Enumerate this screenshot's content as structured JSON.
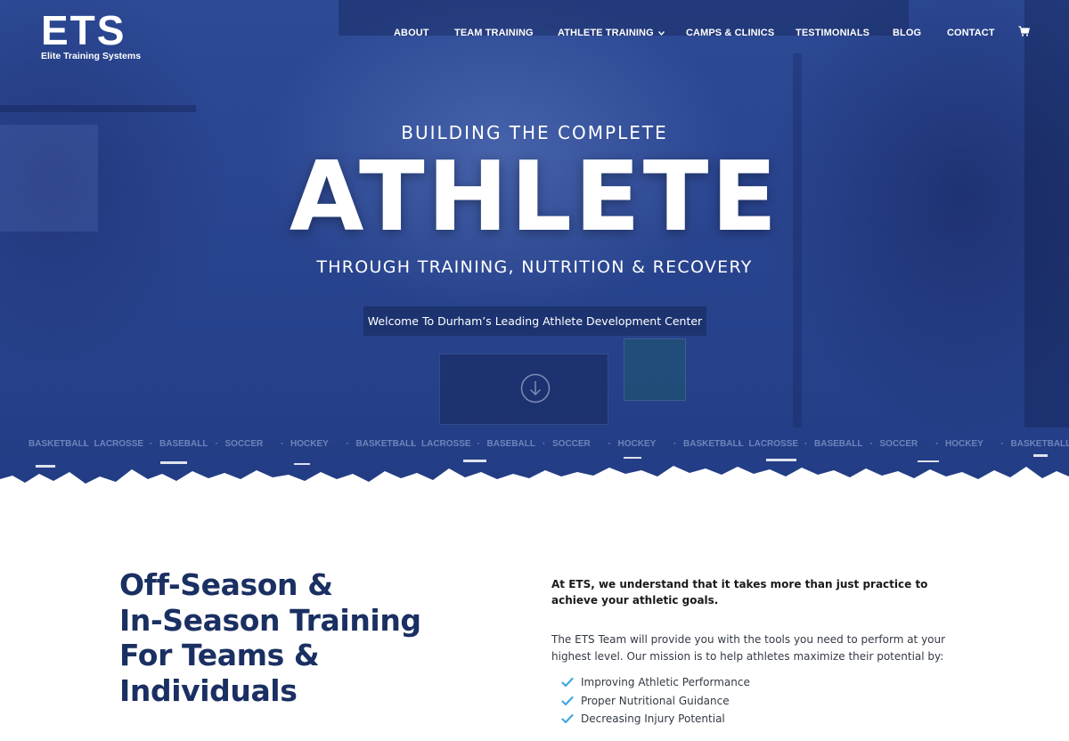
{
  "brand": {
    "logo_text": "ETS",
    "logo_subtitle": "Elite Training Systems",
    "accent_color": "#2a4590",
    "heading_color": "#1a2f62",
    "check_color": "#3fa9e0"
  },
  "nav": {
    "items": [
      {
        "label": "ABOUT"
      },
      {
        "label": "TEAM TRAINING"
      },
      {
        "label": "ATHLETE TRAINING",
        "has_dropdown": true
      },
      {
        "label": "CAMPS & CLINICS"
      },
      {
        "label": "TESTIMONIALS"
      },
      {
        "label": "BLOG"
      },
      {
        "label": "CONTACT"
      }
    ],
    "cart_icon": "cart-icon"
  },
  "hero": {
    "kicker": "BUILDING THE COMPLETE",
    "headline": "ATHLETE",
    "subline": "THROUGH TRAINING, NUTRITION & RECOVERY",
    "welcome_label": "Welcome To Durham’s Leading Athlete Development Center",
    "scroll_icon": "arrow-down-circle-icon",
    "ticker_items": [
      "BASKETBALL",
      "LACROSSE",
      "BASEBALL",
      "SOCCER",
      "HOCKEY",
      "BASKETBALL",
      "LACROSSE",
      "BASEBALL",
      "SOCCER",
      "HOCKEY",
      "BASKETBALL",
      "LACROSSE",
      "BASEBALL",
      "SOCCER",
      "HOCKEY",
      "BASKETBALL"
    ]
  },
  "intro": {
    "heading_lines": [
      "Off-Season &",
      "In-Season Training",
      "For Teams &",
      "Individuals"
    ],
    "lead": "At ETS, we understand that it takes more than just practice to achieve your athletic goals.",
    "body": "The ETS Team will provide you with the tools you need to perform at your highest level. Our mission is to help athletes maximize their potential by:",
    "bullets": [
      "Improving Athletic Performance",
      "Proper Nutritional Guidance",
      "Decreasing Injury Potential"
    ]
  }
}
